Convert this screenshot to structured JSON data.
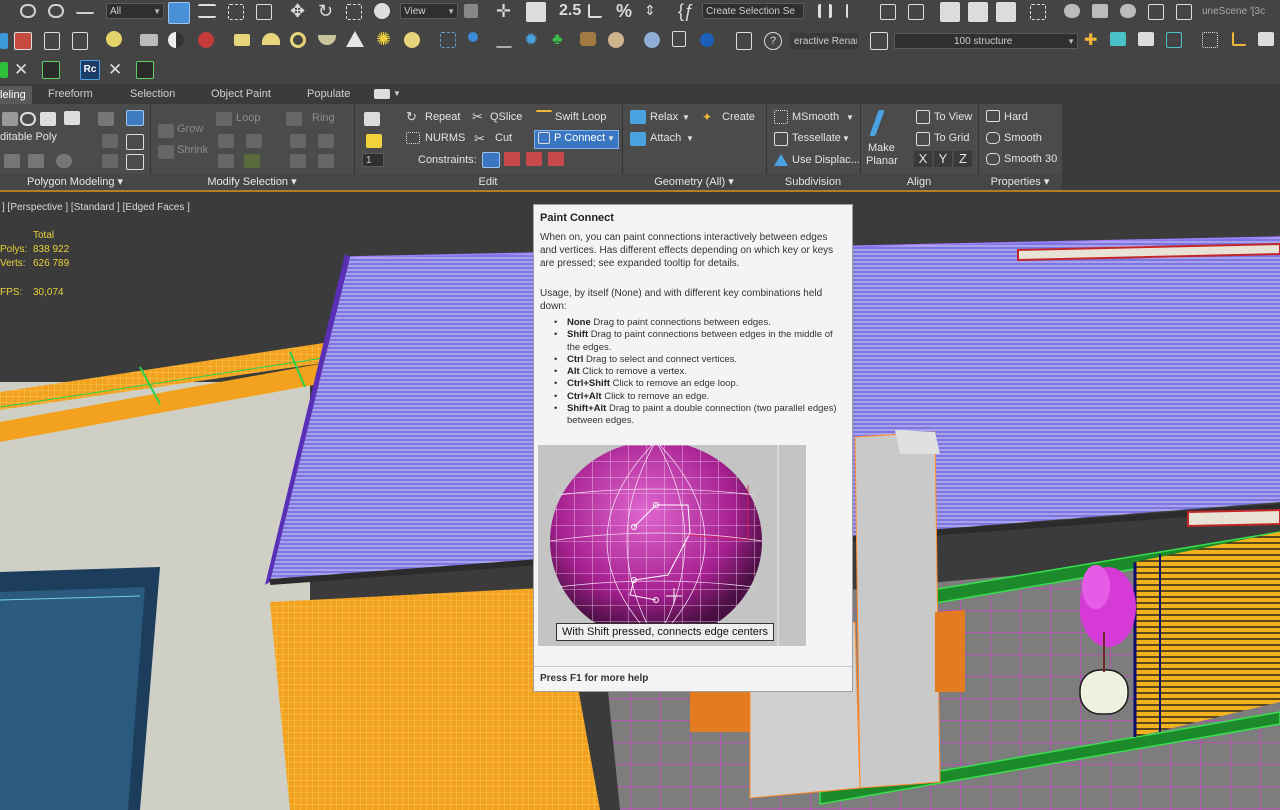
{
  "toolbar_main": {
    "filter_value": "All",
    "ref_coord_value": "View",
    "selection_set_value": "Create Selection Se",
    "scene_name": "uneScene '[3c",
    "snap_value": "2.5"
  },
  "toolbar_second": {
    "renderer_value": "eractive Renar",
    "layer_value": "100  structure"
  },
  "tabs": [
    {
      "label": "leling",
      "active": true
    },
    {
      "label": "Freeform"
    },
    {
      "label": "Selection"
    },
    {
      "label": "Object Paint"
    },
    {
      "label": "Populate"
    }
  ],
  "ribbon": {
    "polygon_modeling": {
      "editable_poly_label": "ditable Poly",
      "title": "Polygon Modeling ▾"
    },
    "modify_selection": {
      "grow": "Grow",
      "shrink": "Shrink",
      "loop": "Loop",
      "ring": "Ring",
      "title": "Modify Selection ▾"
    },
    "edit": {
      "repeat": "Repeat",
      "qslice": "QSlice",
      "swift_loop": "Swift Loop",
      "nurms": "NURMS",
      "cut": "Cut",
      "p_connect": "P Connect",
      "constraints": "Constraints:",
      "num_value": "1",
      "title": "Edit"
    },
    "geometry": {
      "relax": "Relax",
      "create": "Create",
      "attach": "Attach",
      "title": "Geometry (All) ▾"
    },
    "subdivision": {
      "msmooth": "MSmooth",
      "tessellate": "Tessellate",
      "use_displace": "Use Displac...",
      "title": "Subdivision"
    },
    "align": {
      "make_planar": "Make",
      "make_planar2": "Planar",
      "to_view": "To View",
      "to_grid": "To Grid",
      "x": "X",
      "y": "Y",
      "z": "Z",
      "title": "Align"
    },
    "properties": {
      "hard": "Hard",
      "smooth": "Smooth",
      "smooth30": "Smooth 30",
      "title": "Properties ▾"
    }
  },
  "viewport": {
    "label": "] [Perspective ] [Standard ] [Edged Faces ]",
    "stats": {
      "total_label": "Total",
      "polys_label": "Polys:",
      "polys_value": "838 922",
      "verts_label": "Verts:",
      "verts_value": "626 789",
      "fps_label": "FPS:",
      "fps_value": "30,074"
    }
  },
  "tooltip": {
    "title": "Paint Connect",
    "p1": "When on, you can paint connections interactively between edges and vertices. Has different effects depending on which key or keys are pressed; see expanded tooltip for details.",
    "p2": "Usage, by itself (None) and with different key combinations held down:",
    "items": [
      {
        "key": "None",
        "text": " Drag to paint connections between edges."
      },
      {
        "key": "Shift",
        "text": " Drag to paint connections between edges in the middle of the edges."
      },
      {
        "key": "Ctrl",
        "text": " Drag to select and connect vertices."
      },
      {
        "key": "Alt",
        "text": " Click to remove a vertex."
      },
      {
        "key": "Ctrl+Shift",
        "text": " Click to remove an edge loop."
      },
      {
        "key": "Ctrl+Alt",
        "text": " Click to remove an edge."
      },
      {
        "key": "Shift+Alt",
        "text": " Drag to paint a double connection (two parallel edges) between edges."
      }
    ],
    "caption": "With Shift pressed, connects edge centers",
    "footer": "Press F1 for more help"
  },
  "colors": {
    "accent_orange": "#b47d1e",
    "roof_purple": "#7a6fd6",
    "floor_orange": "#f2a21e",
    "sphere_magenta": "#b02a9c"
  }
}
